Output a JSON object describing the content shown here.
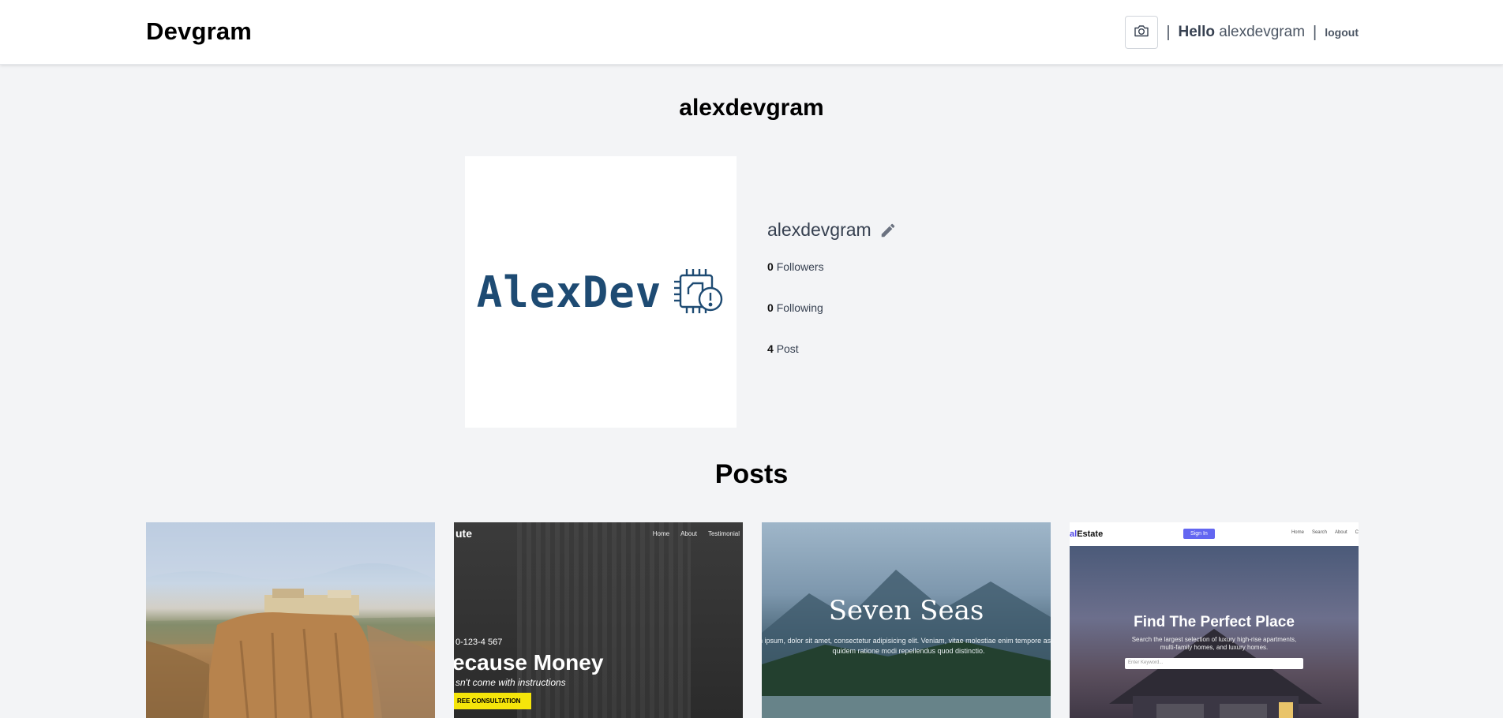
{
  "header": {
    "brand": "Devgram",
    "separator": "|",
    "hello_label": "Hello",
    "username": "alexdevgram",
    "logout_label": "logout"
  },
  "profile": {
    "title": "alexdevgram",
    "avatar_text": "AlexDev",
    "username": "alexdevgram",
    "followers_count": "0",
    "followers_label": "Followers",
    "following_count": "0",
    "following_label": "Following",
    "posts_count": "4",
    "posts_label": "Post"
  },
  "posts_section": {
    "title": "Posts",
    "items": [
      {
        "kind": "photo-cliff-town"
      },
      {
        "logo": "ute",
        "nav": [
          "Home",
          "About",
          "Testimonial"
        ],
        "phone": "0-123-4 567",
        "headline": "ecause Money",
        "sub": "sn't come with instructions",
        "cta": "REE CONSULTATION"
      },
      {
        "title": "Seven Seas",
        "text_line1": "n ipsum, dolor sit amet, consectetur adipisicing elit. Veniam, vitae molestiae enim tempore aspe",
        "text_line2": "quidem ratione modi repellendus quod distinctio."
      },
      {
        "brand_prefix": "al",
        "brand_suffix": "Estate",
        "signin": "Sign In",
        "links": [
          "Home",
          "Search",
          "About",
          "C"
        ],
        "headline": "Find The Perfect Place",
        "sub_line1": "Search the largest selection of luxury high-rise apartments,",
        "sub_line2": "multi-family homes, and luxury homes.",
        "search_placeholder": "Enter Keyword..."
      }
    ]
  },
  "colors": {
    "page_bg": "#f3f4f6",
    "header_bg": "#ffffff",
    "avatar_text": "#1e4b73",
    "accent_indigo": "#6366f1",
    "cta_yellow": "#f5e50a"
  },
  "icons": [
    "camera-icon",
    "pencil-icon",
    "chip-alert-icon"
  ]
}
